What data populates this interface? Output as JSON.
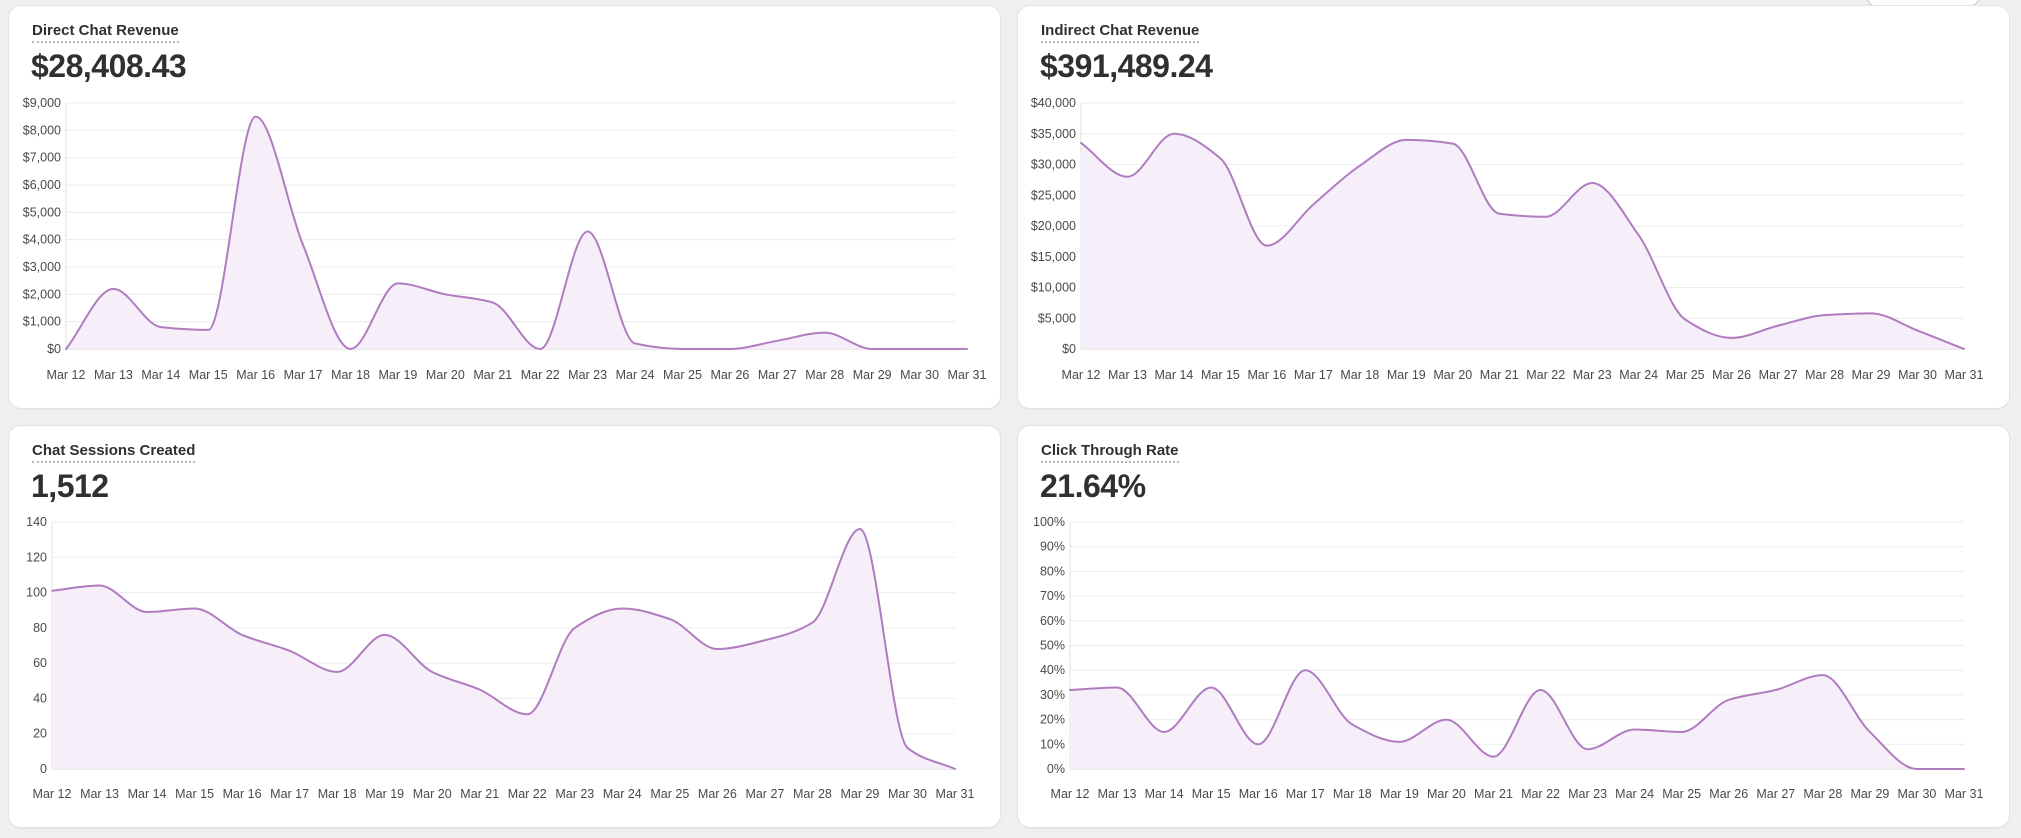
{
  "cards": [
    {
      "title": "Direct Chat Revenue",
      "value": "$28,408.43",
      "chart_data": {
        "type": "area",
        "x": [
          "Mar 12",
          "Mar 13",
          "Mar 14",
          "Mar 15",
          "Mar 16",
          "Mar 17",
          "Mar 18",
          "Mar 19",
          "Mar 20",
          "Mar 21",
          "Mar 22",
          "Mar 23",
          "Mar 24",
          "Mar 25",
          "Mar 26",
          "Mar 27",
          "Mar 28",
          "Mar 29",
          "Mar 30",
          "Mar 31"
        ],
        "values": [
          0,
          2200,
          800,
          700,
          8500,
          3800,
          0,
          2400,
          2000,
          1700,
          0,
          4300,
          200,
          0,
          0,
          300,
          600,
          0,
          0,
          0
        ],
        "ylim": [
          0,
          9000
        ],
        "yticks": [
          0,
          1000,
          2000,
          3000,
          4000,
          5000,
          6000,
          7000,
          8000,
          9000
        ],
        "yticklabels": [
          "$0",
          "$1,000",
          "$2,000",
          "$3,000",
          "$4,000",
          "$5,000",
          "$6,000",
          "$7,000",
          "$8,000",
          "$9,000"
        ],
        "xlabel": "",
        "ylabel": "",
        "grid": true,
        "color": "#b07cc0",
        "fill": "#f6eef8"
      }
    },
    {
      "title": "Indirect Chat Revenue",
      "value": "$391,489.24",
      "chart_data": {
        "type": "area",
        "x": [
          "Mar 12",
          "Mar 13",
          "Mar 14",
          "Mar 15",
          "Mar 16",
          "Mar 17",
          "Mar 18",
          "Mar 19",
          "Mar 20",
          "Mar 21",
          "Mar 22",
          "Mar 23",
          "Mar 24",
          "Mar 25",
          "Mar 26",
          "Mar 27",
          "Mar 28",
          "Mar 29",
          "Mar 30",
          "Mar 31"
        ],
        "values": [
          33500,
          28000,
          35000,
          31000,
          16800,
          23500,
          29800,
          34000,
          33400,
          22000,
          21500,
          27000,
          18500,
          4800,
          1800,
          3800,
          5500,
          5800,
          3000,
          0
        ],
        "ylim": [
          0,
          40000
        ],
        "yticks": [
          0,
          5000,
          10000,
          15000,
          20000,
          25000,
          30000,
          35000,
          40000
        ],
        "yticklabels": [
          "$0",
          "$5,000",
          "$10,000",
          "$15,000",
          "$20,000",
          "$25,000",
          "$30,000",
          "$35,000",
          "$40,000"
        ],
        "xlabel": "",
        "ylabel": "",
        "grid": true,
        "color": "#b07cc0",
        "fill": "#f6eef8"
      }
    },
    {
      "title": "Chat Sessions Created",
      "value": "1,512",
      "chart_data": {
        "type": "area",
        "x": [
          "Mar 12",
          "Mar 13",
          "Mar 14",
          "Mar 15",
          "Mar 16",
          "Mar 17",
          "Mar 18",
          "Mar 19",
          "Mar 20",
          "Mar 21",
          "Mar 22",
          "Mar 23",
          "Mar 24",
          "Mar 25",
          "Mar 26",
          "Mar 27",
          "Mar 28",
          "Mar 29",
          "Mar 30",
          "Mar 31"
        ],
        "values": [
          101,
          104,
          89,
          91,
          76,
          67,
          55,
          76,
          55,
          45,
          31,
          80,
          91,
          85,
          68,
          73,
          83,
          136,
          12,
          0
        ],
        "ylim": [
          0,
          140
        ],
        "yticks": [
          0,
          20,
          40,
          60,
          80,
          100,
          120,
          140
        ],
        "yticklabels": [
          "0",
          "20",
          "40",
          "60",
          "80",
          "100",
          "120",
          "140"
        ],
        "xlabel": "",
        "ylabel": "",
        "grid": true,
        "color": "#b07cc0",
        "fill": "#f6eef8"
      }
    },
    {
      "title": "Click Through Rate",
      "value": "21.64%",
      "chart_data": {
        "type": "area",
        "x": [
          "Mar 12",
          "Mar 13",
          "Mar 14",
          "Mar 15",
          "Mar 16",
          "Mar 17",
          "Mar 18",
          "Mar 19",
          "Mar 20",
          "Mar 21",
          "Mar 22",
          "Mar 23",
          "Mar 24",
          "Mar 25",
          "Mar 26",
          "Mar 27",
          "Mar 28",
          "Mar 29",
          "Mar 30",
          "Mar 31"
        ],
        "values": [
          32,
          33,
          15,
          33,
          10,
          40,
          18,
          11,
          20,
          5,
          32,
          8,
          16,
          15,
          28,
          32,
          38,
          15,
          0,
          0
        ],
        "ylim": [
          0,
          100
        ],
        "yticks": [
          0,
          10,
          20,
          30,
          40,
          50,
          60,
          70,
          80,
          90,
          100
        ],
        "yticklabels": [
          "0%",
          "10%",
          "20%",
          "30%",
          "40%",
          "50%",
          "60%",
          "70%",
          "80%",
          "90%",
          "100%"
        ],
        "xlabel": "",
        "ylabel": "",
        "grid": true,
        "color": "#b07cc0",
        "fill": "#f6eef8"
      }
    }
  ]
}
